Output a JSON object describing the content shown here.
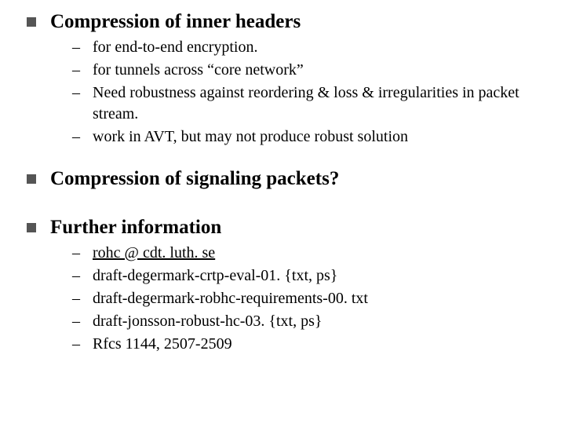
{
  "sections": [
    {
      "heading": "Compression of inner headers",
      "items": [
        {
          "text": "for end-to-end encryption.",
          "link": false
        },
        {
          "text": "for tunnels across “core network”",
          "link": false
        },
        {
          "text": "Need robustness against reordering & loss & irregularities in packet stream.",
          "link": false
        },
        {
          "text": "work in AVT, but may not produce robust solution",
          "link": false
        }
      ]
    },
    {
      "heading": "Compression of signaling packets?",
      "items": []
    },
    {
      "heading": "Further information",
      "items": [
        {
          "text": "rohc @ cdt. luth. se",
          "link": true
        },
        {
          "text": "draft-degermark-crtp-eval-01. {txt, ps}",
          "link": false
        },
        {
          "text": "draft-degermark-robhc-requirements-00. txt",
          "link": false
        },
        {
          "text": "draft-jonsson-robust-hc-03. {txt, ps}",
          "link": false
        },
        {
          "text": "Rfcs 1144, 2507-2509",
          "link": false
        }
      ]
    }
  ]
}
